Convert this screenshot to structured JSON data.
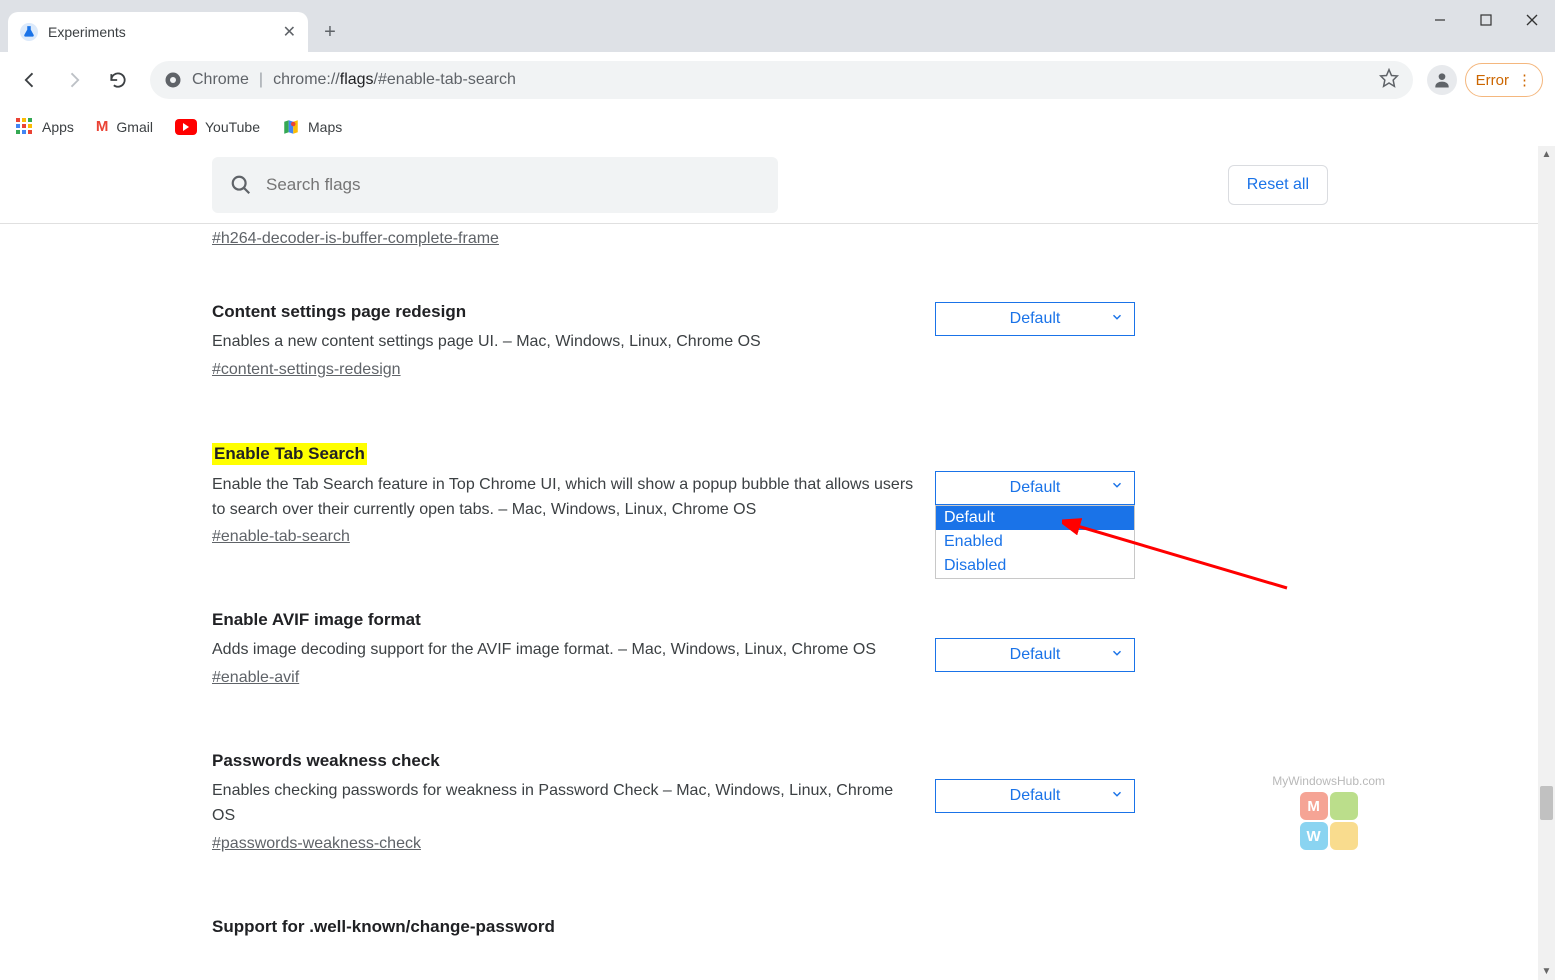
{
  "window": {
    "tab_title": "Experiments"
  },
  "omnibox": {
    "origin_label": "Chrome",
    "url_prefix": "chrome://",
    "url_bold": "flags",
    "url_rest": "/#enable-tab-search"
  },
  "error_pill": "Error",
  "bookmarks": {
    "apps": "Apps",
    "gmail": "Gmail",
    "youtube": "YouTube",
    "maps": "Maps"
  },
  "header": {
    "search_placeholder": "Search flags",
    "reset": "Reset all"
  },
  "top_hash": "#h264-decoder-is-buffer-complete-frame",
  "flags": [
    {
      "title": "Content settings page redesign",
      "desc": "Enables a new content settings page UI. – Mac, Windows, Linux, Chrome OS",
      "hash": "#content-settings-redesign",
      "value": "Default"
    },
    {
      "title": "Enable Tab Search",
      "desc": "Enable the Tab Search feature in Top Chrome UI, which will show a popup bubble that allows users to search over their currently open tabs. – Mac, Windows, Linux, Chrome OS",
      "hash": "#enable-tab-search",
      "value": "Default",
      "highlight": true,
      "dropdown": [
        "Default",
        "Enabled",
        "Disabled"
      ]
    },
    {
      "title": "Enable AVIF image format",
      "desc": "Adds image decoding support for the AVIF image format. – Mac, Windows, Linux, Chrome OS",
      "hash": "#enable-avif",
      "value": "Default"
    },
    {
      "title": "Passwords weakness check",
      "desc": "Enables checking passwords for weakness in Password Check – Mac, Windows, Linux, Chrome OS",
      "hash": "#passwords-weakness-check",
      "value": "Default"
    },
    {
      "title": "Support for .well-known/change-password",
      "desc": "",
      "hash": "",
      "value": ""
    }
  ],
  "watermark": "MyWindowsHub.com"
}
